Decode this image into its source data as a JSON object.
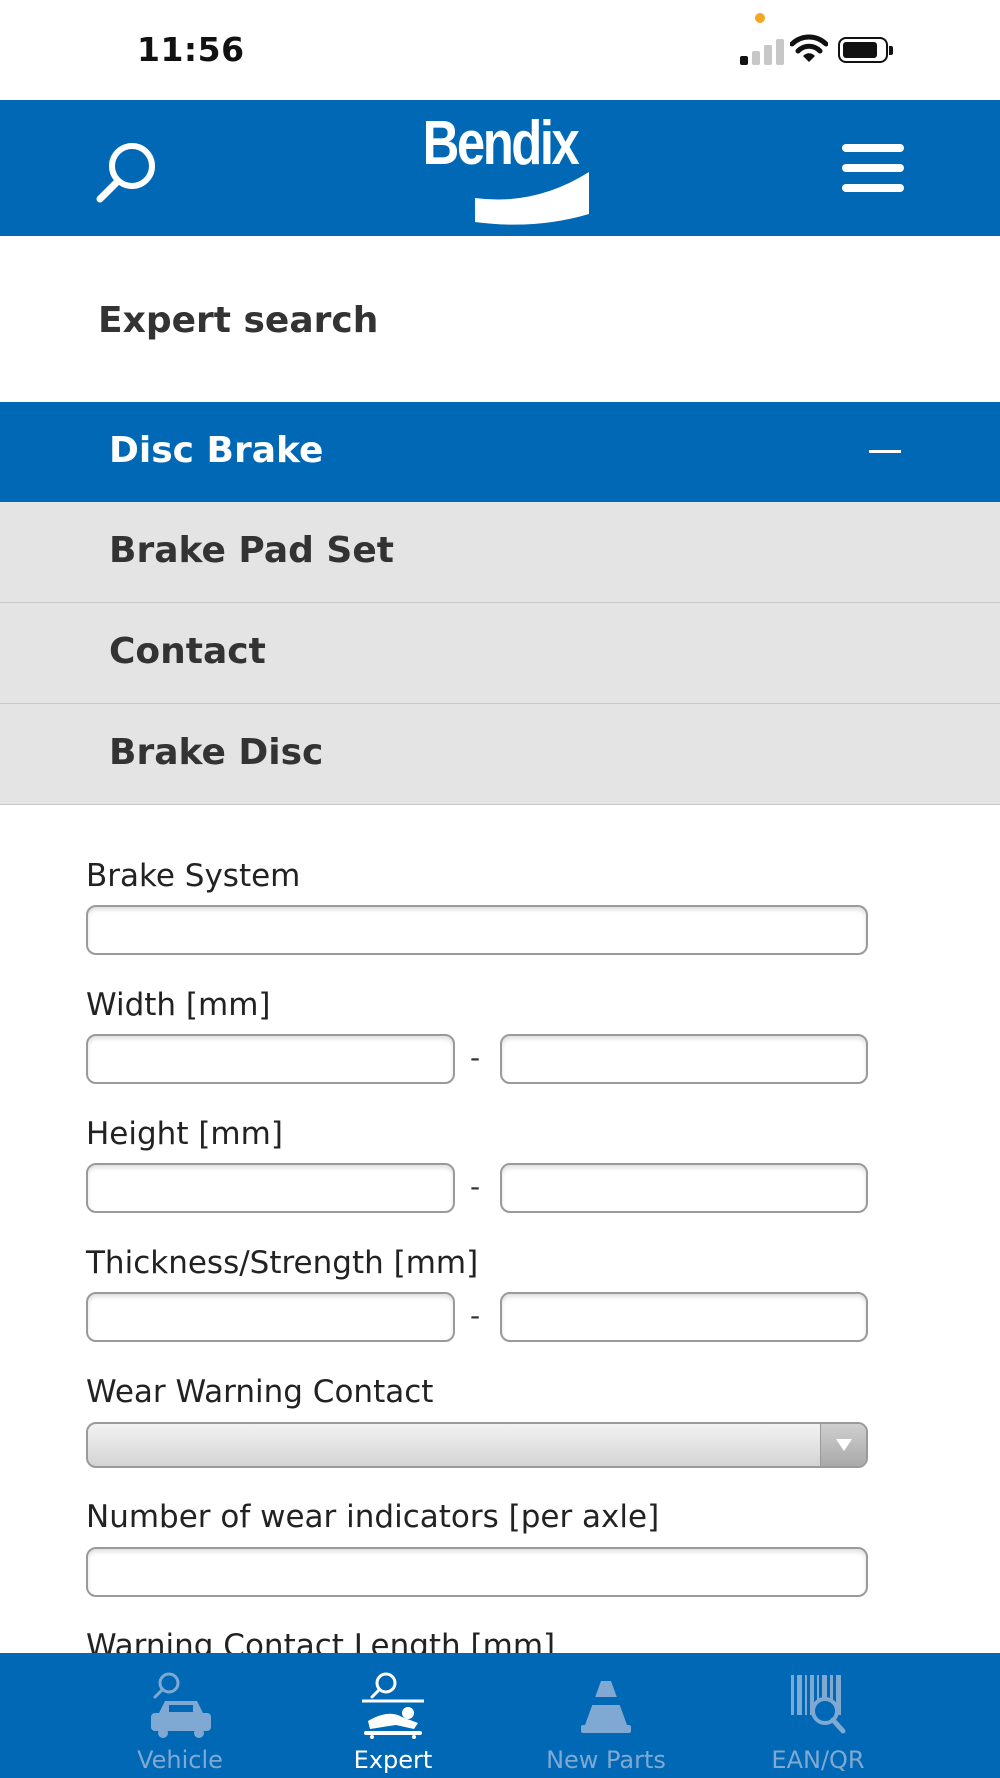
{
  "status_bar": {
    "time": "11:56"
  },
  "header": {
    "logo_text": "Bendix",
    "brand_color": "#0068b4",
    "left_icon": "search-icon",
    "right_icon": "hamburger-menu-icon"
  },
  "page": {
    "title": "Expert search"
  },
  "accordion": {
    "items": [
      {
        "label": "Disc Brake",
        "expanded": true
      },
      {
        "label": "Brake Pad Set",
        "expanded": false
      },
      {
        "label": "Contact",
        "expanded": false
      },
      {
        "label": "Brake Disc",
        "expanded": false
      }
    ]
  },
  "form": {
    "brake_system": {
      "label": "Brake System",
      "value": ""
    },
    "width": {
      "label": "Width [mm]",
      "from": "",
      "to": "",
      "separator": "-"
    },
    "height": {
      "label": "Height [mm]",
      "from": "",
      "to": "",
      "separator": "-"
    },
    "thickness": {
      "label": "Thickness/Strength [mm]",
      "from": "",
      "to": "",
      "separator": "-"
    },
    "wear_warning_contact": {
      "label": "Wear Warning Contact",
      "selected": ""
    },
    "wear_indicators": {
      "label": "Number of wear indicators [per axle]",
      "value": ""
    },
    "warning_contact_length": {
      "label": "Warning Contact Length [mm]"
    }
  },
  "tab_bar": {
    "tabs": [
      {
        "label": "Vehicle",
        "icon": "car-search-icon",
        "active": false
      },
      {
        "label": "Expert",
        "icon": "mechanic-search-icon",
        "active": true
      },
      {
        "label": "New Parts",
        "icon": "traffic-cone-icon",
        "active": false
      },
      {
        "label": "EAN/QR",
        "icon": "barcode-search-icon",
        "active": false
      }
    ]
  }
}
